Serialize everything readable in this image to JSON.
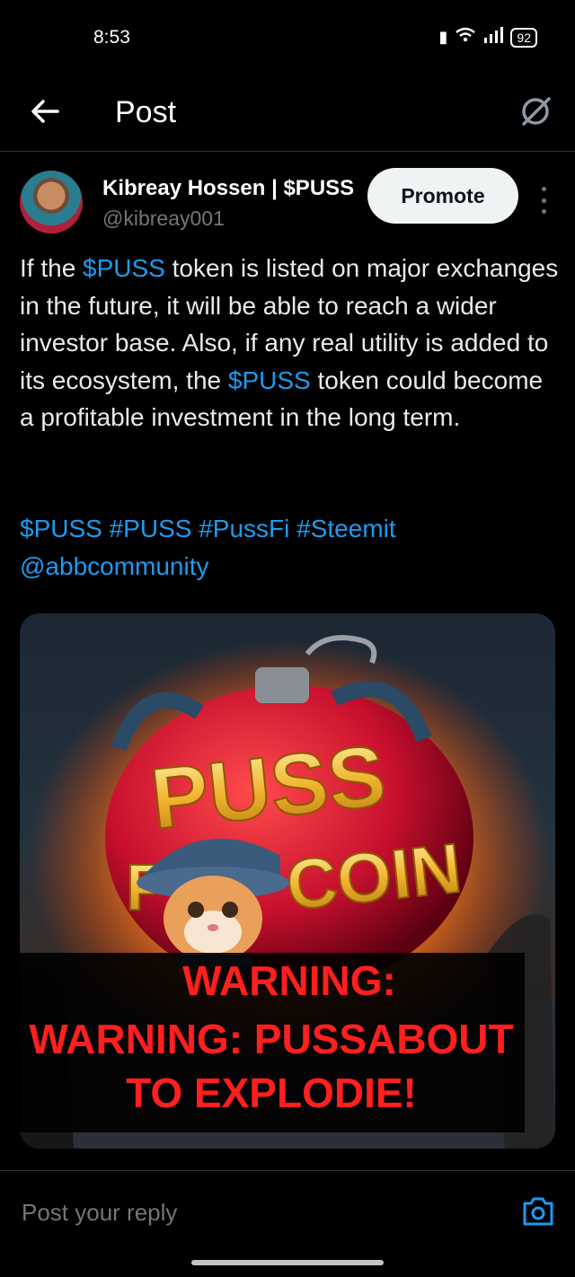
{
  "status_bar": {
    "time": "8:53",
    "battery": "92"
  },
  "header": {
    "title": "Post"
  },
  "author": {
    "name": "Kibreay Hossen | $PUSS",
    "handle": "@kibreay001"
  },
  "actions": {
    "promote_label": "Promote"
  },
  "post": {
    "parts": [
      "If the ",
      "$PUSS",
      " token is listed on major exchanges in the future, it will be able to reach a wider investor base. Also, if any real utility is added to its ecosystem, the ",
      "$PUSS",
      " token could become a profitable investment in the long term."
    ],
    "hashtags": [
      "$PUSS",
      "#PUSS",
      "#PussFi",
      "#Steemit"
    ],
    "mention": "@abbcommunity"
  },
  "media": {
    "logo_top": "PUSS",
    "logo_left": "P",
    "logo_right": "COIN",
    "warning_line1": "WARNING:",
    "warning_line2": "WARNING: PUSSABOUT",
    "warning_line3": "TO EXPLODIE!"
  },
  "reply": {
    "placeholder": "Post your reply"
  },
  "colors": {
    "accent": "#1d9bf0",
    "background": "#000000",
    "warning": "#ff1f1f"
  }
}
